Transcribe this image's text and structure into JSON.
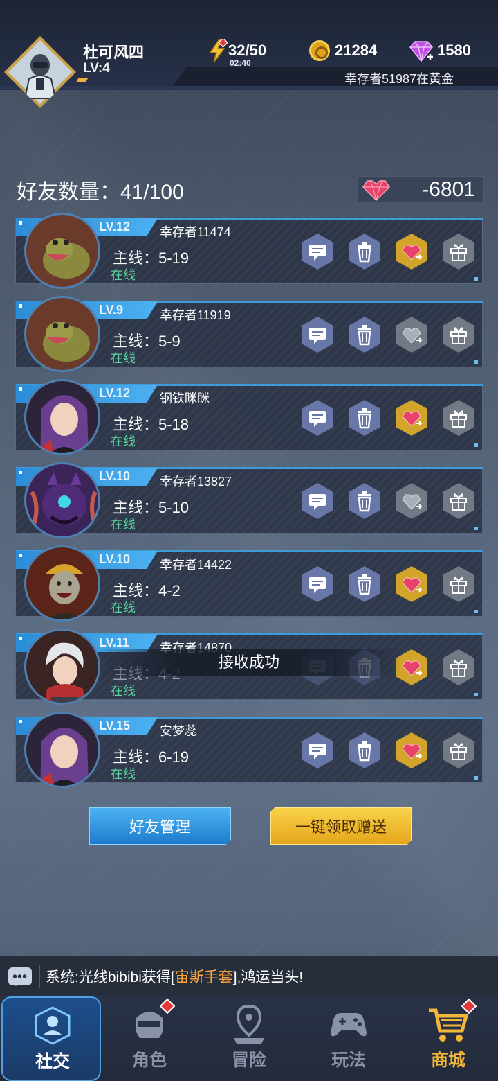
{
  "player": {
    "name": "杜可风四",
    "level": "LV:4"
  },
  "resources": {
    "energy": "32/50",
    "energy_timer": "02:40",
    "gold": "21284",
    "gems": "1580",
    "icons": [
      "lightning-icon",
      "coin-icon",
      "gem-icon"
    ]
  },
  "ticker": "幸存者51987在黄金",
  "friends": {
    "count_label": "好友数量：41/100",
    "hearts": "-6801",
    "rows": [
      {
        "level": "LV.12",
        "name": "幸存者11474",
        "main": "主线：5-19",
        "status": "在线",
        "gift_state": "gold"
      },
      {
        "level": "LV.9",
        "name": "幸存者11919",
        "main": "主线：5-9",
        "status": "在线",
        "gift_state": "grey"
      },
      {
        "level": "LV.12",
        "name": "钢铁眯眯",
        "main": "主线：5-18",
        "status": "在线",
        "gift_state": "gold"
      },
      {
        "level": "LV.10",
        "name": "幸存者13827",
        "main": "主线：5-10",
        "status": "在线",
        "gift_state": "grey"
      },
      {
        "level": "LV.10",
        "name": "幸存者14422",
        "main": "主线：4-2",
        "status": "在线",
        "gift_state": "gold"
      },
      {
        "level": "LV.11",
        "name": "幸存者14870",
        "main": "主线：4-2",
        "status": "在线",
        "gift_state": "gold"
      },
      {
        "level": "LV.15",
        "name": "安梦蕊",
        "main": "主线：6-19",
        "status": "在线",
        "gift_state": "gold"
      }
    ]
  },
  "toast": "接收成功",
  "buttons": {
    "manage": "好友管理",
    "claim_all": "一键领取赠送"
  },
  "chat": {
    "prefix": "系统:光线bibibi获得[",
    "item": "宙斯手套",
    "suffix": "],鸿运当头!"
  },
  "nav": [
    {
      "label": "社交",
      "active": true
    },
    {
      "label": "角色",
      "badge": true
    },
    {
      "label": "冒险"
    },
    {
      "label": "玩法"
    },
    {
      "label": "商城",
      "badge": true
    }
  ],
  "colors": {
    "online": "#5bd39c",
    "accent_blue": "#3e9bd9",
    "gold": "#d2a42a",
    "shop": "#f1b63a"
  }
}
